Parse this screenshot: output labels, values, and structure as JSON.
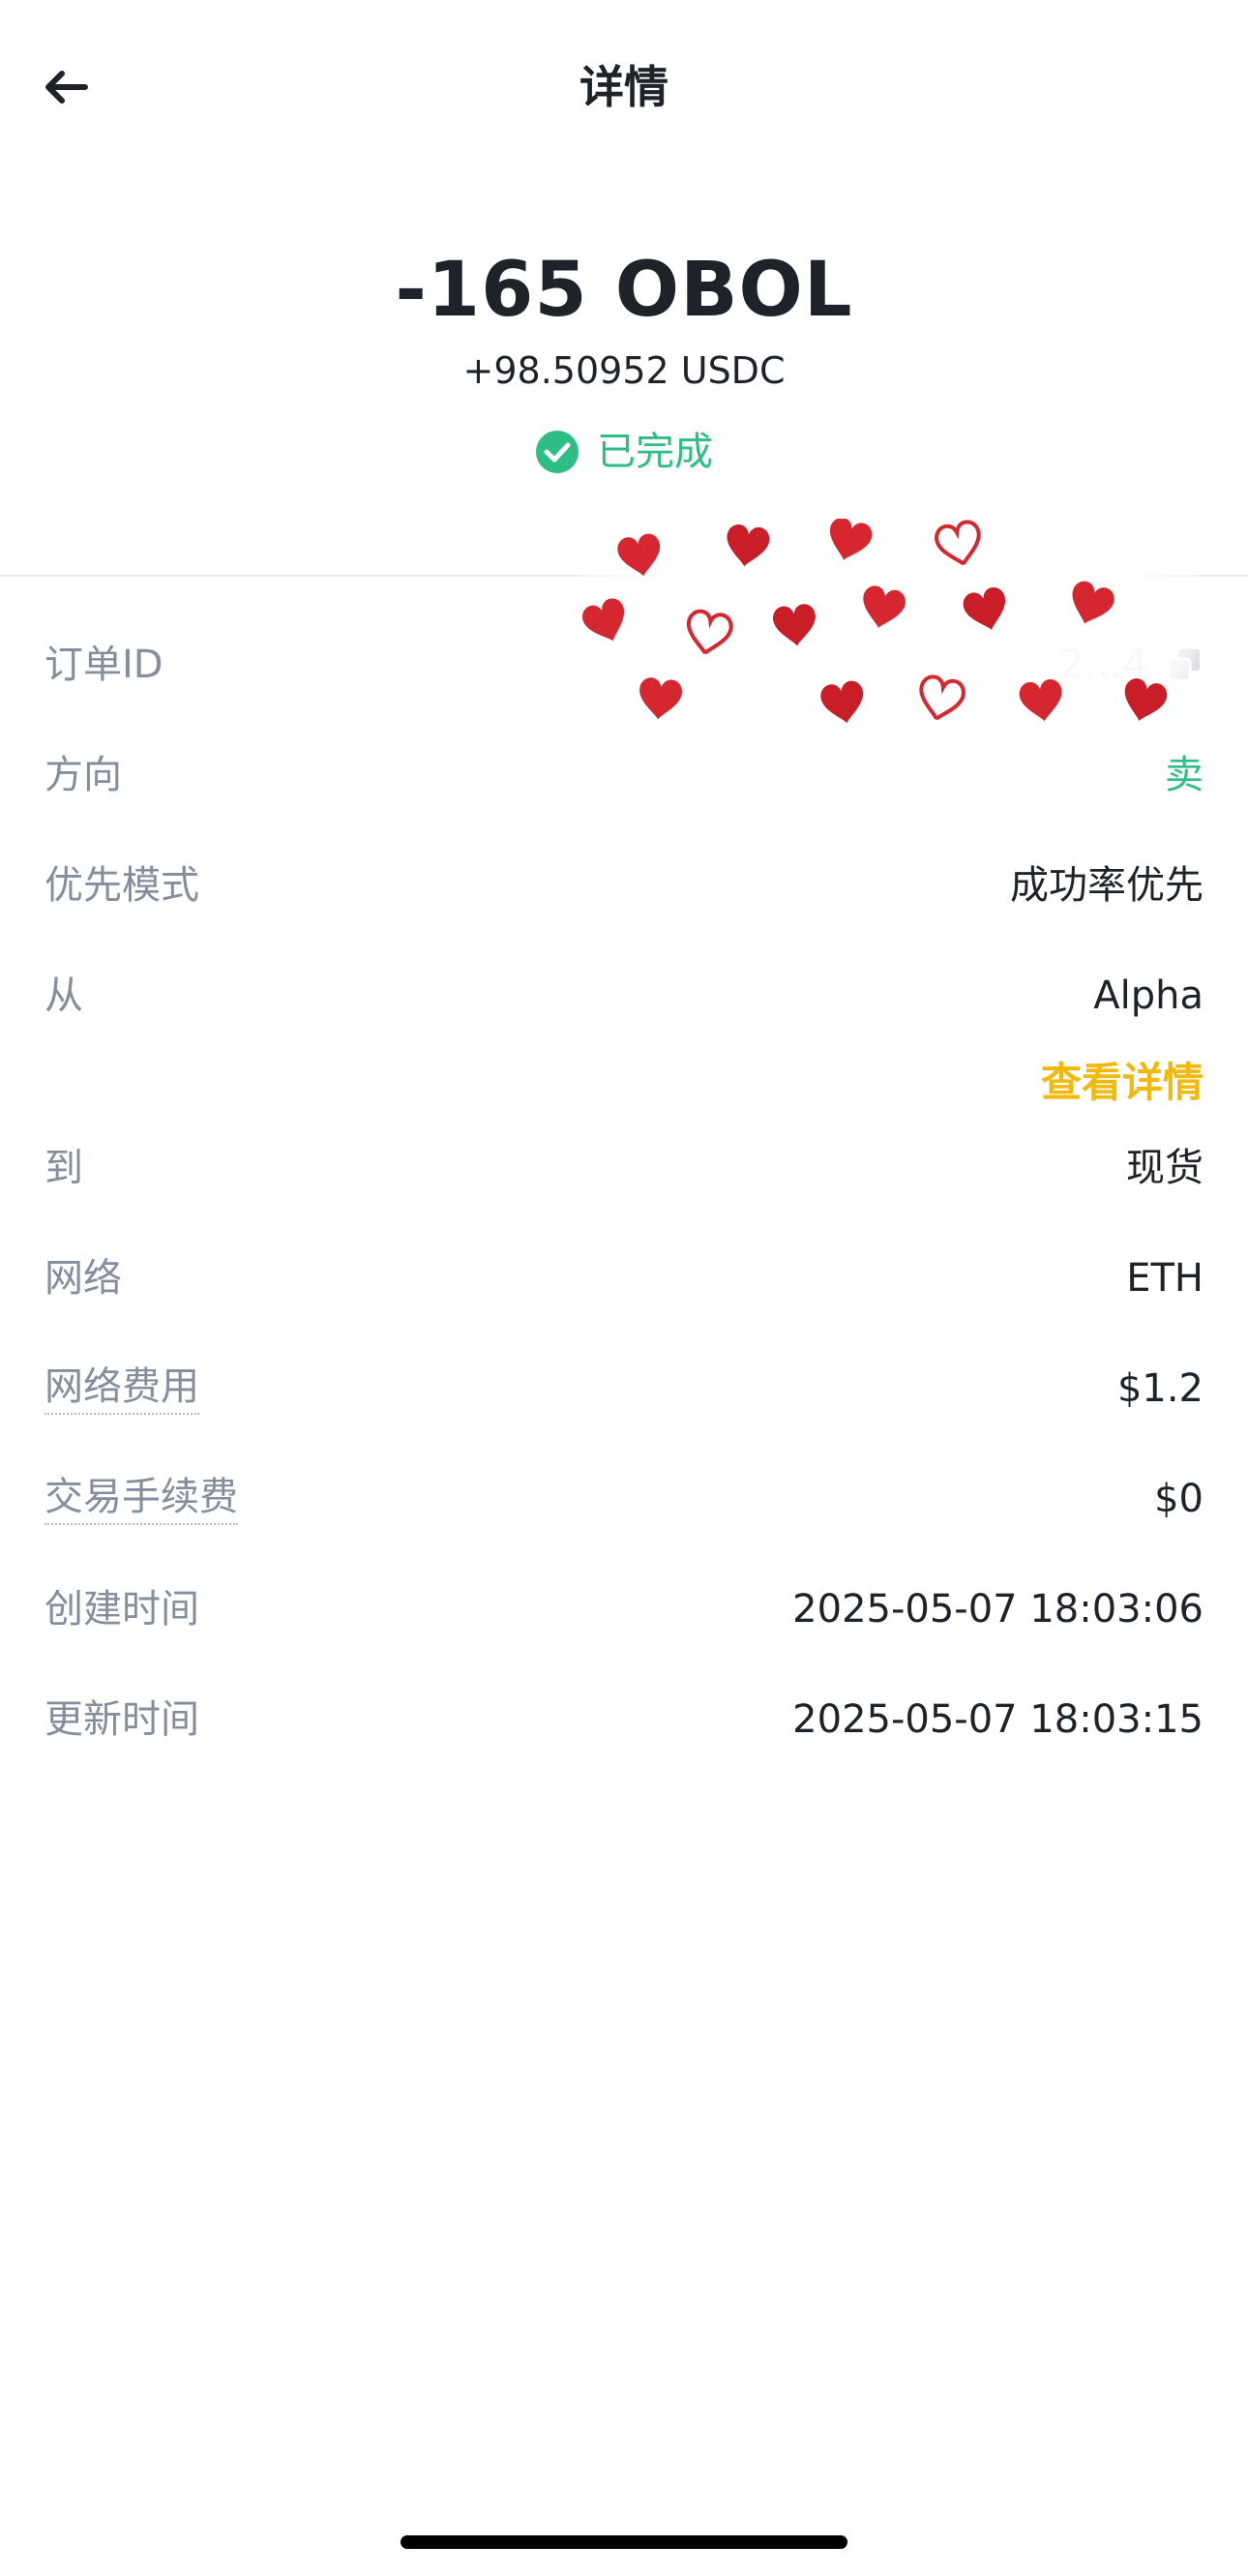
{
  "header": {
    "title": "详情"
  },
  "summary": {
    "amount": "-165 OBOL",
    "received": "+98.50952 USDC",
    "status": "已完成"
  },
  "details": {
    "order_id": {
      "label": "订单ID",
      "value": "2…4"
    },
    "direction": {
      "label": "方向",
      "value": "卖"
    },
    "priority": {
      "label": "优先模式",
      "value": "成功率优先"
    },
    "from": {
      "label": "从",
      "value": "Alpha",
      "link": "查看详情"
    },
    "to": {
      "label": "到",
      "value": "现货"
    },
    "network": {
      "label": "网络",
      "value": "ETH"
    },
    "network_fee": {
      "label": "网络费用",
      "value": "$1.2"
    },
    "trading_fee": {
      "label": "交易手续费",
      "value": "$0"
    },
    "created": {
      "label": "创建时间",
      "value": "2025-05-07 18:03:06"
    },
    "updated": {
      "label": "更新时间",
      "value": "2025-05-07 18:03:15"
    }
  },
  "colors": {
    "text": "#1e2329",
    "muted": "#848e9c",
    "success": "#2ebd85",
    "accent": "#f0b90b",
    "divider": "#eaecef",
    "heart": "#d6262f"
  },
  "icons": {
    "back": "arrow-left-icon",
    "status": "check-circle-icon",
    "copy": "copy-icon",
    "sticker": "hearts-sticker"
  }
}
